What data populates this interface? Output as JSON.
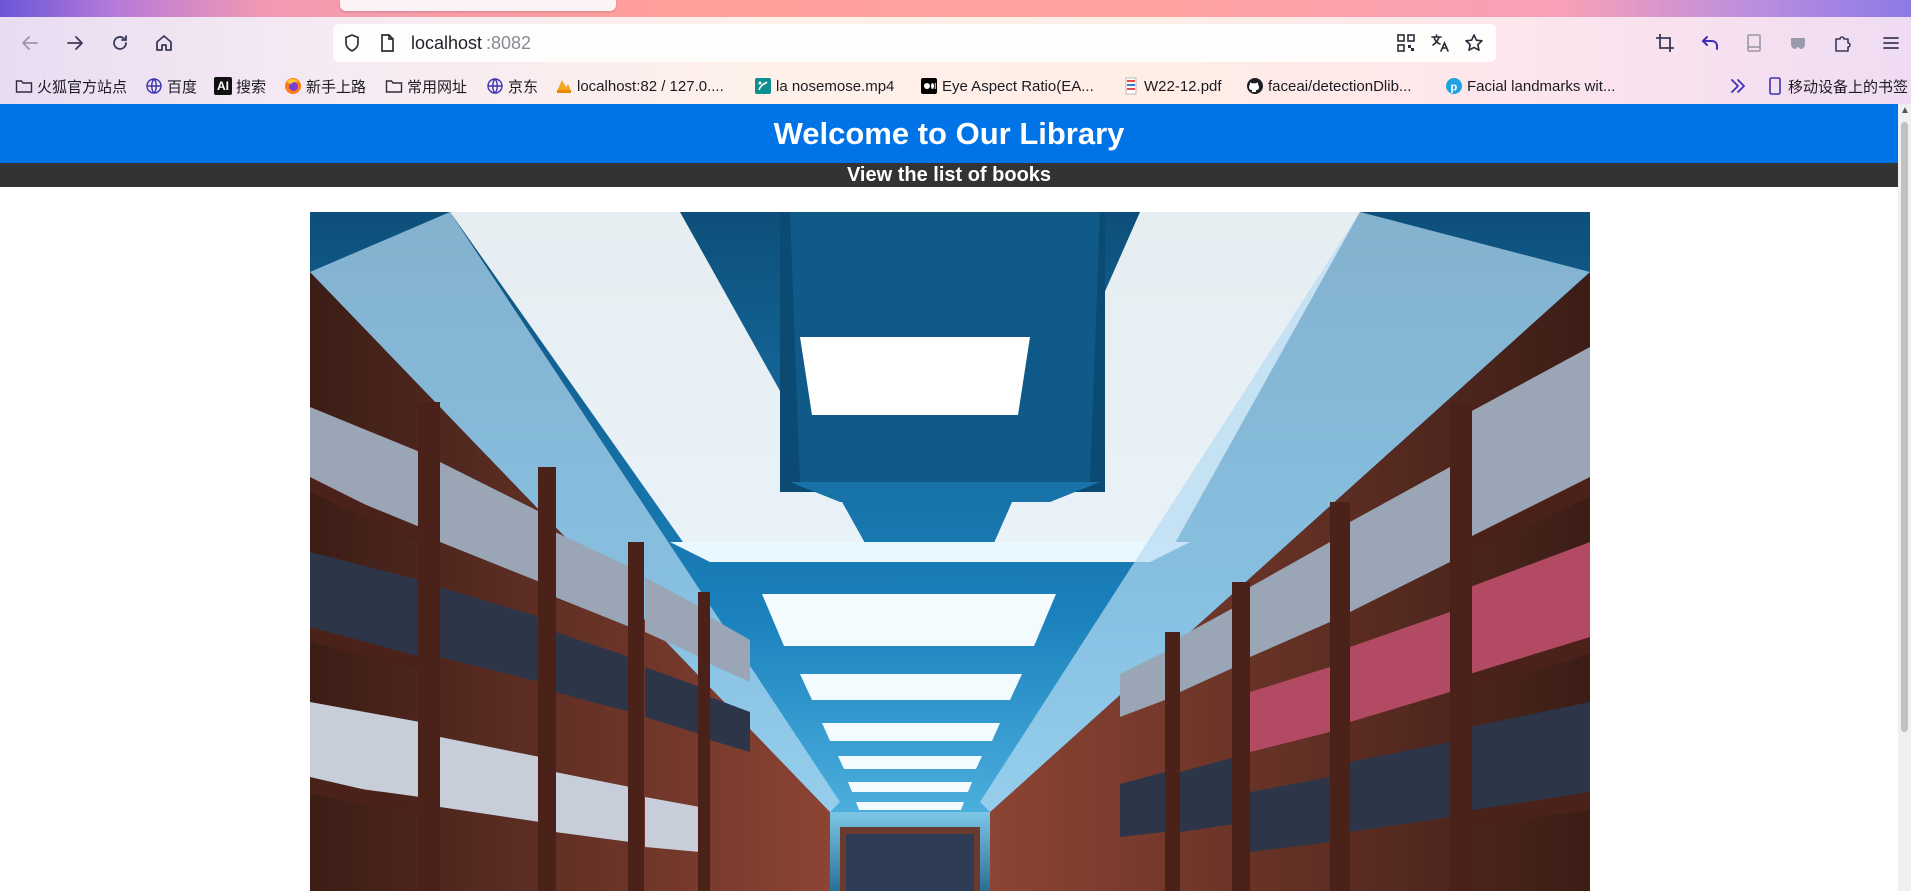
{
  "browser": {
    "url_host": "localhost",
    "url_port": ":8082",
    "bookmarks": [
      {
        "label": "火狐官方站点",
        "icon": "folder-icon"
      },
      {
        "label": "百度",
        "icon": "globe-icon"
      },
      {
        "label": "搜索",
        "icon": "ai-icon"
      },
      {
        "label": "新手上路",
        "icon": "firefox-icon"
      },
      {
        "label": "常用网址",
        "icon": "folder-icon"
      },
      {
        "label": "京东",
        "icon": "globe-icon"
      },
      {
        "label": "localhost:82 / 127.0....",
        "icon": "phpmyadmin-icon"
      },
      {
        "label": "la nosemose.mp4",
        "icon": "video-icon"
      },
      {
        "label": "Eye Aspect Ratio(EA...",
        "icon": "medium-icon"
      },
      {
        "label": "W22-12.pdf",
        "icon": "pdf-icon"
      },
      {
        "label": "faceai/detectionDlib...",
        "icon": "github-icon"
      },
      {
        "label": "Facial landmarks wit...",
        "icon": "p-icon"
      }
    ],
    "mobile_bookmarks": "移动设备上的书签",
    "ai_icon_text": "AI"
  },
  "page": {
    "title": "Welcome to Our Library",
    "nav_link": "View the list of books"
  },
  "colors": {
    "header_bg": "#0073e6",
    "nav_bg": "#333333",
    "text_on_dark": "#ffffff"
  }
}
